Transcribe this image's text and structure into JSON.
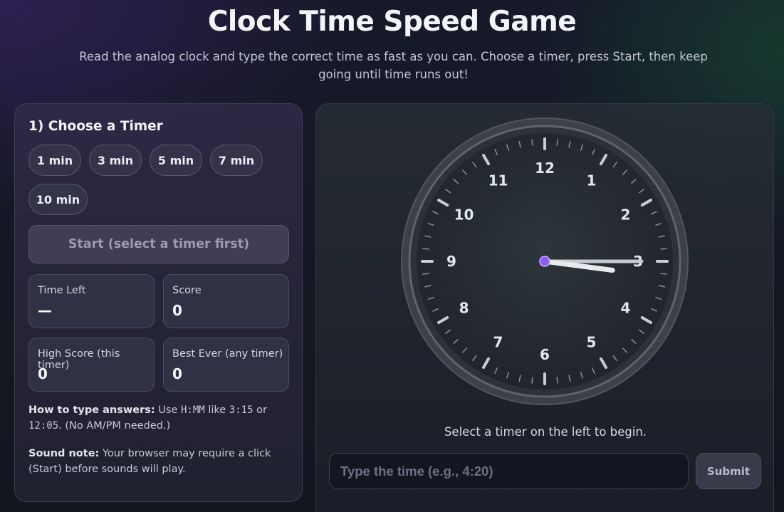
{
  "header": {
    "title": "Clock Time Speed Game",
    "subtitle": "Read the analog clock and type the correct time as fast as you can. Choose a timer, press Start, then keep going until time runs out!"
  },
  "setup": {
    "section_title": "1) Choose a Timer",
    "timers": [
      "1 min",
      "3 min",
      "5 min",
      "7 min",
      "10 min"
    ],
    "start_label": "Start (select a timer first)"
  },
  "stats": {
    "time_left_label": "Time Left",
    "time_left_value": "—",
    "score_label": "Score",
    "score_value": "0",
    "high_score_label": "High Score (this timer)",
    "high_score_value": "0",
    "best_ever_label": "Best Ever (any timer)",
    "best_ever_value": "0"
  },
  "notes": {
    "how_to_label": "How to type answers:",
    "how_to_text_1": "Use",
    "how_to_format": "H:MM",
    "how_to_text_2": "like",
    "how_to_example_1": "3:15",
    "how_to_text_3": "or",
    "how_to_example_2": "12:05",
    "how_to_text_4": ". (No AM/PM needed.)",
    "sound_label": "Sound note:",
    "sound_text": "Your browser may require a click (Start) before sounds will play."
  },
  "clock": {
    "numbers": [
      "12",
      "1",
      "2",
      "3",
      "4",
      "5",
      "6",
      "7",
      "8",
      "9",
      "10",
      "11"
    ],
    "hour": 3,
    "minute": 15,
    "center_color": "#8b5cf6"
  },
  "game": {
    "status_text": "Select a timer on the left to begin.",
    "input_placeholder": "Type the time (e.g., 4:20)",
    "input_value": "",
    "submit_label": "Submit"
  }
}
